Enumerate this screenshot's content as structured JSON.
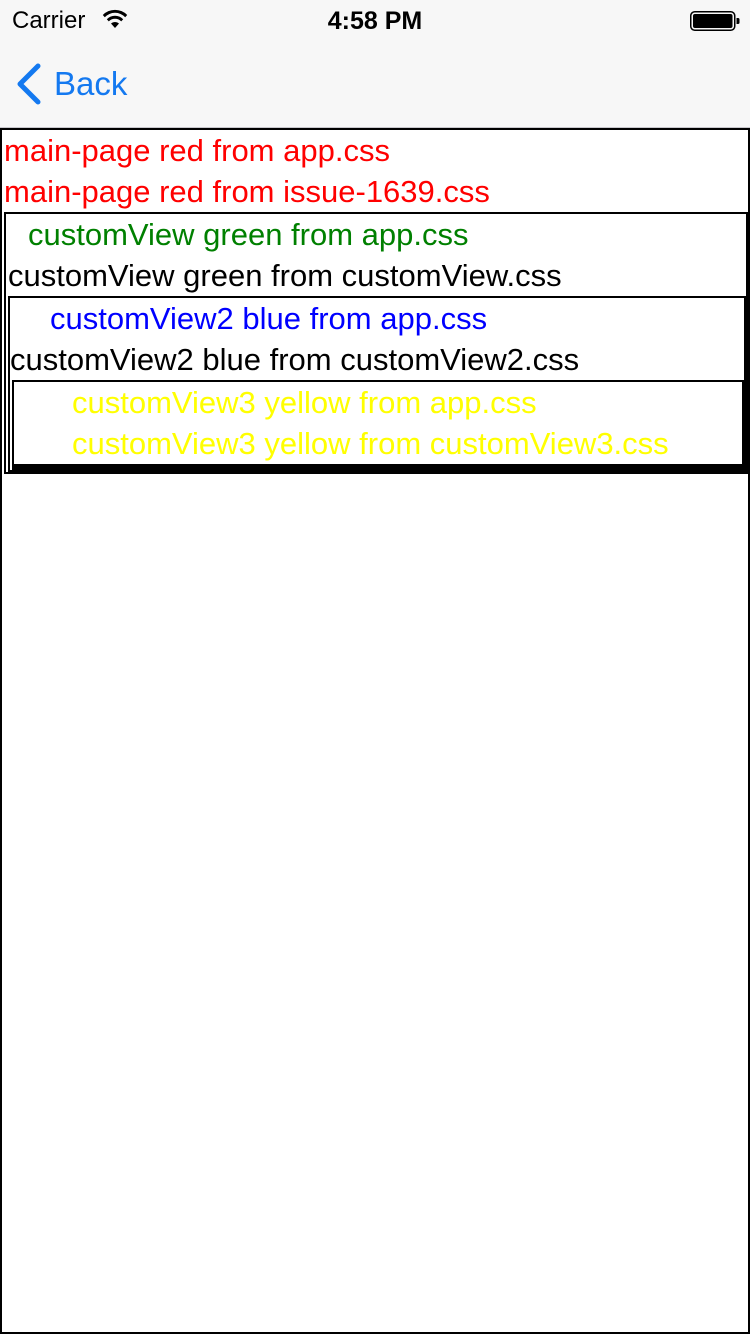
{
  "status_bar": {
    "carrier": "Carrier",
    "time": "4:58 PM",
    "wifi_icon": "wifi-icon",
    "battery_icon": "battery-full-icon"
  },
  "nav": {
    "back_label": "Back",
    "back_icon": "chevron-left-icon",
    "accent_color": "#1479f0"
  },
  "main_page": {
    "lines": [
      "main-page red from app.css",
      "main-page red from issue-1639.css"
    ],
    "color": "#ff0000"
  },
  "custom_view": {
    "line_app": "customView green from app.css",
    "line_own": "customView green from customView.css",
    "app_color": "#008000",
    "own_color": "#000000"
  },
  "custom_view2": {
    "line_app": "customView2 blue from app.css",
    "line_own": "customView2 blue from customView2.css",
    "app_color": "#0000ff",
    "own_color": "#000000"
  },
  "custom_view3": {
    "line_app": "customView3 yellow from app.css",
    "line_own": "customView3 yellow from customView3.css",
    "color": "#ffff00"
  }
}
